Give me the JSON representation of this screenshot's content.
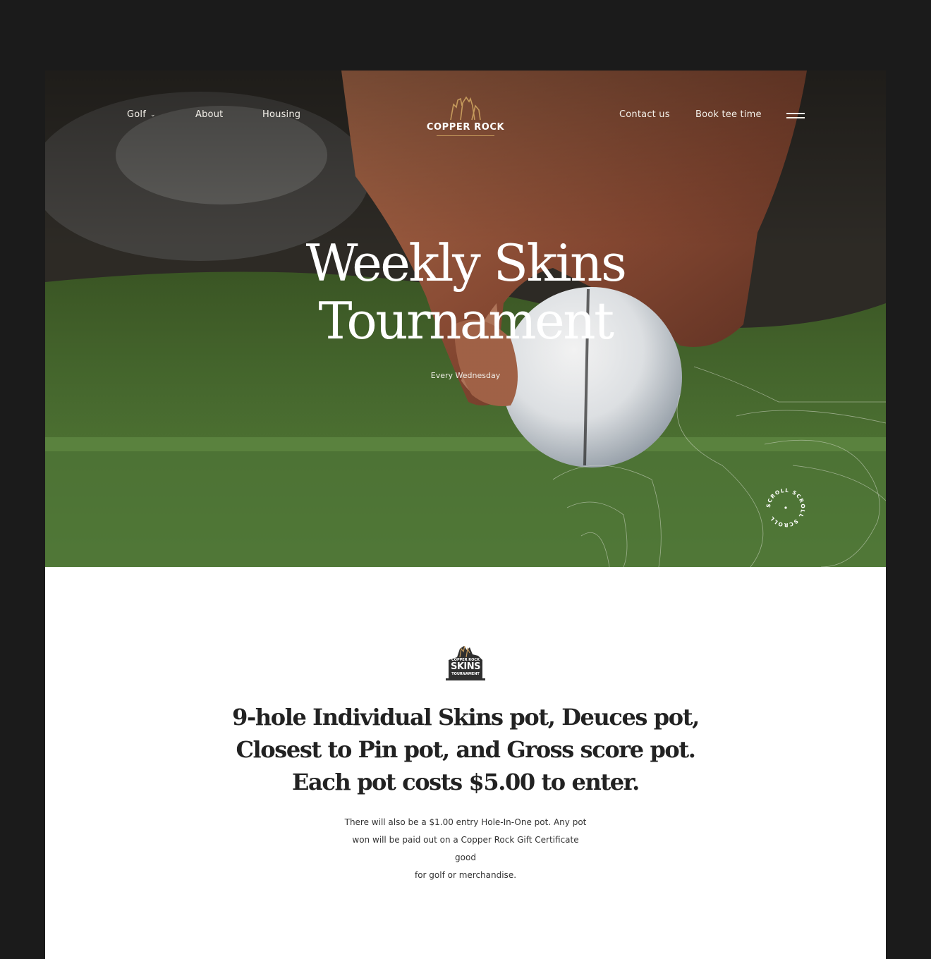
{
  "nav": {
    "left": [
      {
        "label": "Golf",
        "has_dropdown": true
      },
      {
        "label": "About"
      },
      {
        "label": "Housing"
      }
    ],
    "right": [
      {
        "label": "Contact us"
      },
      {
        "label": "Book tee time"
      }
    ],
    "menu_icon": "hamburger-icon"
  },
  "logo": {
    "wordmark": "COPPER ROCK",
    "icon": "copper-rock-logo",
    "accent_color": "#c59a5c"
  },
  "hero": {
    "title_line1": "Weekly Skins",
    "title_line2": "Tournament",
    "subtitle": "Every Wednesday",
    "scroll_label": "SCROLL SCROLL SCROLL"
  },
  "content": {
    "badge": {
      "top": "COPPER ROCK",
      "middle": "SKINS",
      "bottom": "TOURNAMENT"
    },
    "headline_line1": "9-hole Individual Skins pot, Deuces pot,",
    "headline_line2": "Closest to Pin pot, and Gross score pot.",
    "headline_line3": "Each pot costs $5.00 to enter.",
    "body_line1": "There will also be a $1.00 entry Hole-In-One pot. Any pot",
    "body_line2": "won will be paid out on a Copper Rock Gift Certificate good",
    "body_line3": "for golf or merchandise."
  },
  "colors": {
    "frame": "#1b1b1b",
    "page": "#ffffff",
    "grass": "#4f7233",
    "headline": "#222222"
  }
}
